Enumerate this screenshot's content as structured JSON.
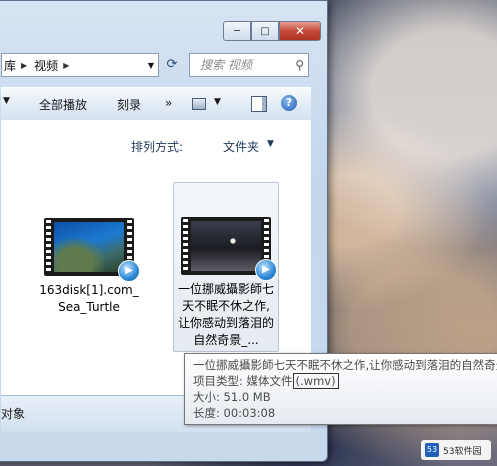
{
  "window": {
    "caption": {
      "minimize": "─",
      "maximize": "□",
      "close": "✕"
    }
  },
  "address": {
    "crumbs": [
      "库",
      "视频"
    ]
  },
  "search": {
    "placeholder": "搜索 视频"
  },
  "toolbar": {
    "play_all": "全部播放",
    "burn": "刻录",
    "more": "»"
  },
  "view": {
    "arrange_label": "排列方式:",
    "arrange_value": "文件夹"
  },
  "files": [
    {
      "name": "163disk[1].com_Sea_Turtle",
      "icon": "video-thumbnail-sea-turtle"
    },
    {
      "name": "一位挪威攝影師七天不眠不休之作,让你感动到落泪的自然奇景_...",
      "icon": "video-thumbnail-night-sky"
    }
  ],
  "status": {
    "text": "对象"
  },
  "tooltip": {
    "title": "一位挪威攝影師七天不眠不休之作,让你感动到落泪的自然奇景",
    "type_label": "项目类型: 媒体文件",
    "type_ext": "(.wmv)",
    "size": "大小: 51.0 MB",
    "length": "长度: 00:03:08"
  },
  "watermark": {
    "text": "53软件园",
    "mark": "53"
  },
  "colors": {
    "accent": "#1f5fb5",
    "close_button": "#c4483a"
  }
}
